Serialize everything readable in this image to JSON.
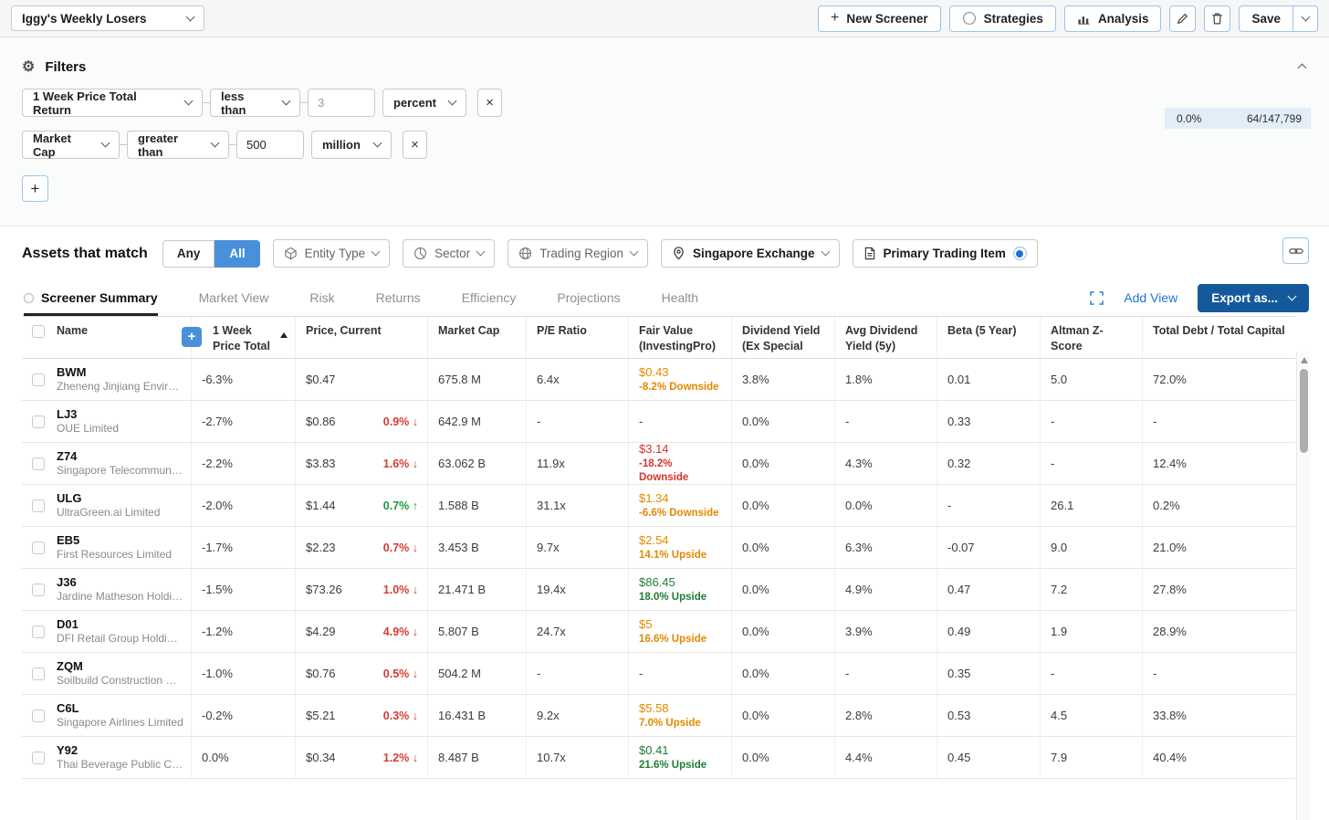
{
  "topbar": {
    "screener_name": "Iggy's Weekly Losers",
    "new_screener": "New Screener",
    "strategies": "Strategies",
    "analysis": "Analysis",
    "save": "Save"
  },
  "filters": {
    "title": "Filters",
    "rows": [
      {
        "field": "1 Week Price Total Return",
        "operator": "less than",
        "value": "3",
        "unit": "percent"
      },
      {
        "field": "Market Cap",
        "operator": "greater than",
        "value": "500",
        "unit": "million"
      }
    ],
    "stats": {
      "percent": "0.0%",
      "count": "64/147,799"
    }
  },
  "assets": {
    "title": "Assets that match",
    "any": "Any",
    "all": "All",
    "chips": [
      {
        "label": "Entity Type"
      },
      {
        "label": "Sector"
      },
      {
        "label": "Trading Region"
      },
      {
        "label": "Singapore Exchange"
      },
      {
        "label": "Primary Trading Item"
      }
    ]
  },
  "tabs": {
    "items": [
      "Screener Summary",
      "Market View",
      "Risk",
      "Returns",
      "Efficiency",
      "Projections",
      "Health"
    ],
    "active": "Screener Summary",
    "add_view": "Add View",
    "export": "Export as..."
  },
  "table": {
    "columns": [
      {
        "key": "name",
        "label": "Name"
      },
      {
        "key": "week",
        "label": "1 Week Price Total",
        "sort": "asc"
      },
      {
        "key": "price",
        "label": "Price, Current"
      },
      {
        "key": "mcap",
        "label": "Market Cap"
      },
      {
        "key": "pe",
        "label": "P/E Ratio"
      },
      {
        "key": "fair",
        "label": "Fair Value (InvestingPro)"
      },
      {
        "key": "divy",
        "label": "Dividend Yield (Ex Special"
      },
      {
        "key": "avgdiv",
        "label": "Avg Dividend Yield (5y)"
      },
      {
        "key": "beta",
        "label": "Beta (5 Year)"
      },
      {
        "key": "altman",
        "label": "Altman Z-Score"
      },
      {
        "key": "debt",
        "label": "Total Debt / Total Capital"
      }
    ],
    "rows": [
      {
        "ticker": "BWM",
        "company": "Zheneng Jinjiang Environm...",
        "week": "-6.3%",
        "price": "$0.47",
        "change": null,
        "mcap": "675.8 M",
        "pe": "6.4x",
        "fair": {
          "price": "$0.43",
          "note": "-8.2% Downside",
          "tone": "orange"
        },
        "divy": "3.8%",
        "avgdiv": "1.8%",
        "beta": "0.01",
        "altman": "5.0",
        "debt": "72.0%"
      },
      {
        "ticker": "LJ3",
        "company": "OUE Limited",
        "week": "-2.7%",
        "price": "$0.86",
        "change": {
          "value": "0.9%",
          "dir": "down"
        },
        "mcap": "642.9 M",
        "pe": "-",
        "fair": null,
        "divy": "0.0%",
        "avgdiv": "-",
        "beta": "0.33",
        "altman": "-",
        "debt": "-"
      },
      {
        "ticker": "Z74",
        "company": "Singapore Telecommunicat...",
        "week": "-2.2%",
        "price": "$3.83",
        "change": {
          "value": "1.6%",
          "dir": "down"
        },
        "mcap": "63.062 B",
        "pe": "11.9x",
        "fair": {
          "price": "$3.14",
          "note": "-18.2% Downside",
          "tone": "red"
        },
        "divy": "0.0%",
        "avgdiv": "4.3%",
        "beta": "0.32",
        "altman": "-",
        "debt": "12.4%"
      },
      {
        "ticker": "ULG",
        "company": "UltraGreen.ai Limited",
        "week": "-2.0%",
        "price": "$1.44",
        "change": {
          "value": "0.7%",
          "dir": "up"
        },
        "mcap": "1.588 B",
        "pe": "31.1x",
        "fair": {
          "price": "$1.34",
          "note": "-6.6% Downside",
          "tone": "orange"
        },
        "divy": "0.0%",
        "avgdiv": "0.0%",
        "beta": "-",
        "altman": "26.1",
        "debt": "0.2%"
      },
      {
        "ticker": "EB5",
        "company": "First Resources Limited",
        "week": "-1.7%",
        "price": "$2.23",
        "change": {
          "value": "0.7%",
          "dir": "down"
        },
        "mcap": "3.453 B",
        "pe": "9.7x",
        "fair": {
          "price": "$2.54",
          "note": "14.1% Upside",
          "tone": "orange"
        },
        "divy": "0.0%",
        "avgdiv": "6.3%",
        "beta": "-0.07",
        "altman": "9.0",
        "debt": "21.0%"
      },
      {
        "ticker": "J36",
        "company": "Jardine Matheson Holdings...",
        "week": "-1.5%",
        "price": "$73.26",
        "change": {
          "value": "1.0%",
          "dir": "down"
        },
        "mcap": "21.471 B",
        "pe": "19.4x",
        "fair": {
          "price": "$86.45",
          "note": "18.0% Upside",
          "tone": "green"
        },
        "divy": "0.0%",
        "avgdiv": "4.9%",
        "beta": "0.47",
        "altman": "7.2",
        "debt": "27.8%"
      },
      {
        "ticker": "D01",
        "company": "DFI Retail Group Holdings ...",
        "week": "-1.2%",
        "price": "$4.29",
        "change": {
          "value": "4.9%",
          "dir": "down"
        },
        "mcap": "5.807 B",
        "pe": "24.7x",
        "fair": {
          "price": "$5",
          "note": "16.6% Upside",
          "tone": "orange"
        },
        "divy": "0.0%",
        "avgdiv": "3.9%",
        "beta": "0.49",
        "altman": "1.9",
        "debt": "28.9%"
      },
      {
        "ticker": "ZQM",
        "company": "Soilbuild Construction Grou...",
        "week": "-1.0%",
        "price": "$0.76",
        "change": {
          "value": "0.5%",
          "dir": "down"
        },
        "mcap": "504.2 M",
        "pe": "-",
        "fair": null,
        "divy": "0.0%",
        "avgdiv": "-",
        "beta": "0.35",
        "altman": "-",
        "debt": "-"
      },
      {
        "ticker": "C6L",
        "company": "Singapore Airlines Limited",
        "week": "-0.2%",
        "price": "$5.21",
        "change": {
          "value": "0.3%",
          "dir": "down"
        },
        "mcap": "16.431 B",
        "pe": "9.2x",
        "fair": {
          "price": "$5.58",
          "note": "7.0% Upside",
          "tone": "orange"
        },
        "divy": "0.0%",
        "avgdiv": "2.8%",
        "beta": "0.53",
        "altman": "4.5",
        "debt": "33.8%"
      },
      {
        "ticker": "Y92",
        "company": "Thai Beverage Public Com...",
        "week": "0.0%",
        "price": "$0.34",
        "change": {
          "value": "1.2%",
          "dir": "down"
        },
        "mcap": "8.487 B",
        "pe": "10.7x",
        "fair": {
          "price": "$0.41",
          "note": "21.6% Upside",
          "tone": "green"
        },
        "divy": "0.0%",
        "avgdiv": "4.4%",
        "beta": "0.45",
        "altman": "7.9",
        "debt": "40.4%"
      }
    ]
  },
  "colors": {
    "accent_blue": "#4a90d9",
    "export_blue": "#15599c",
    "link_blue": "#2176d2",
    "negative_red": "#d93a32",
    "positive_green": "#1a9a3e",
    "fair_orange": "#e08a00",
    "fair_red": "#d6352c",
    "fair_green": "#1e7e34",
    "stats_bg": "#e2edf8"
  }
}
